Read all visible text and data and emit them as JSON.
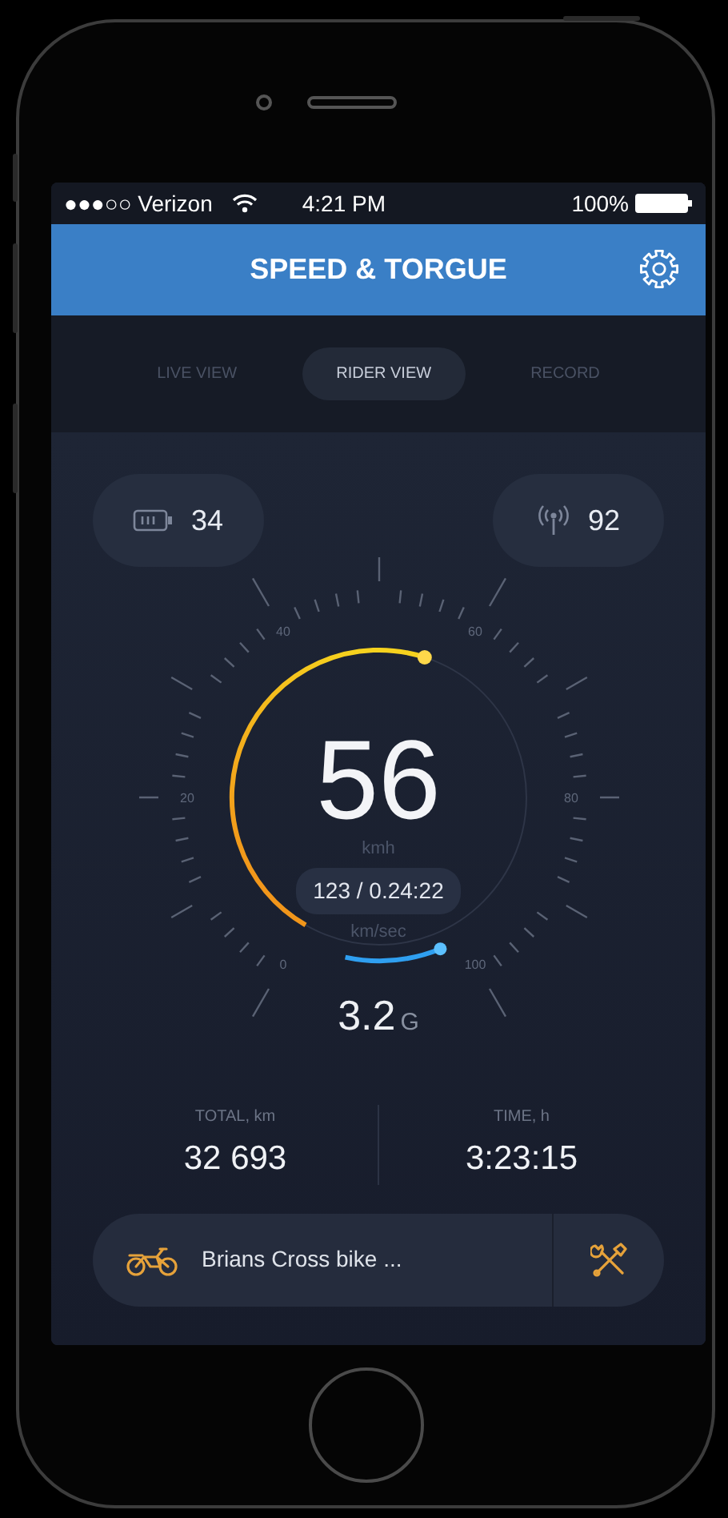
{
  "status_bar": {
    "carrier": "●●●○○ Verizon",
    "time": "4:21 PM",
    "battery": "100%"
  },
  "header": {
    "title": "SPEED & TORGUE"
  },
  "tabs": [
    {
      "label": "LIVE VIEW",
      "selected": false
    },
    {
      "label": "RIDER VIEW",
      "selected": true
    },
    {
      "label": "RECORD",
      "selected": false
    }
  ],
  "badges": [
    {
      "kind": "battery",
      "value": "34"
    },
    {
      "kind": "signal",
      "value": "92"
    }
  ],
  "gauge": {
    "scale_labels": [
      "0",
      "20",
      "40",
      "60",
      "80",
      "100"
    ],
    "speed": "56",
    "speed_unit": "kmh",
    "trip": "123 / 0.24:22",
    "trip_unit": "km/sec",
    "g_force": "3.2",
    "g_unit": "G"
  },
  "stats": [
    {
      "label": "TOTAL, km",
      "value": "32 693"
    },
    {
      "label": "TIME, h",
      "value": "3:23:15"
    }
  ],
  "bike": {
    "name": "Brians Cross bike ..."
  }
}
